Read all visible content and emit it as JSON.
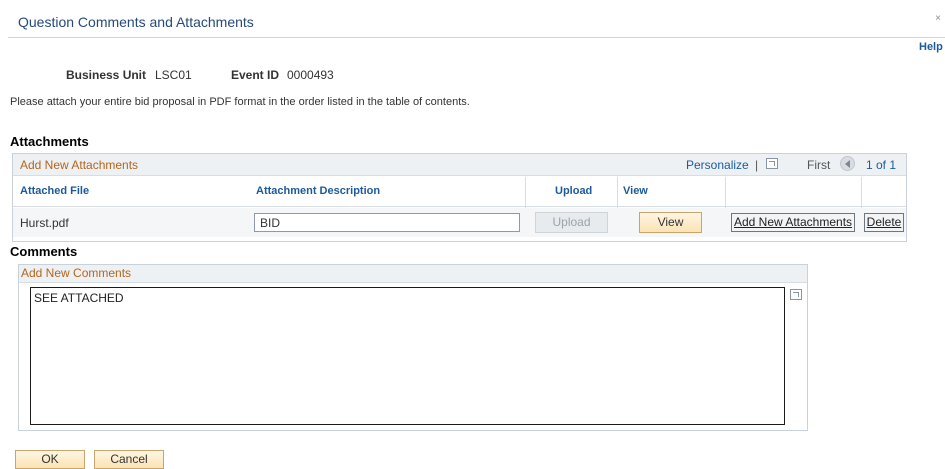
{
  "header": {
    "title": "Question Comments and Attachments",
    "close_glyph": "×",
    "help_label": "Help"
  },
  "info": {
    "business_unit_label": "Business Unit",
    "business_unit_value": "LSC01",
    "event_id_label": "Event ID",
    "event_id_value": "0000493",
    "instructions": "Please attach your entire bid proposal in PDF format in the order listed in the table of contents."
  },
  "attachments": {
    "section_title": "Attachments",
    "grid_title": "Add New Attachments",
    "personalize_label": "Personalize",
    "separator": "|",
    "first_label": "First",
    "count_label": "1 of 1",
    "columns": {
      "attached_file": "Attached File",
      "attachment_description": "Attachment Description",
      "upload": "Upload",
      "view": "View"
    },
    "rows": [
      {
        "file": "Hurst.pdf",
        "description": "BID",
        "upload_label": "Upload",
        "view_label": "View",
        "add_new_label": "Add New Attachments",
        "delete_label": "Delete"
      }
    ]
  },
  "comments": {
    "section_title": "Comments",
    "box_title": "Add New Comments",
    "text": "SEE ATTACHED"
  },
  "footer": {
    "ok_label": "OK",
    "cancel_label": "Cancel"
  },
  "colors": {
    "title": "#264a7a",
    "link": "#1c5a9b",
    "grid_title": "#b5651d",
    "button_fill": "#fbe3b3"
  },
  "icons": [
    "close-icon",
    "zoom-icon",
    "prev-icon"
  ]
}
